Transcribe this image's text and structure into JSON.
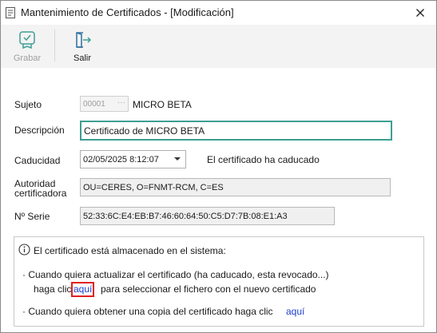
{
  "window": {
    "title": "Mantenimiento de Certificados - [Modificación]"
  },
  "toolbar": {
    "save_label": "Grabar",
    "exit_label": "Salir"
  },
  "form": {
    "subject_label": "Sujeto",
    "subject_code": "00001",
    "subject_name": "MICRO BETA",
    "description_label": "Descripción",
    "description_value": "Certificado de MICRO BETA",
    "expiry_label": "Caducidad",
    "expiry_value": "02/05/2025 8:12:07",
    "expiry_status": "El certificado ha caducado",
    "authority_label_line1": "Autoridad",
    "authority_label_line2": "certificadora",
    "authority_value": "OU=CERES, O=FNMT-RCM, C=ES",
    "serial_label": "Nº Serie",
    "serial_value": "52:33:6C:E4:EB:B7:46:60:64:50:C5:D7:7B:08:E1:A3"
  },
  "info": {
    "heading": "El certificado está almacenado en el sistema:",
    "update_line1": "· Cuando quiera actualizar el certificado (ha caducado, esta revocado...)",
    "update_line2_prefix": "haga clic",
    "update_link": "aquí",
    "update_line2_suffix": "para seleccionar el fichero con el nuevo certificado",
    "copy_line": "· Cuando quiera obtener una copia del certificado haga clic",
    "copy_link": "aquí"
  },
  "colors": {
    "link": "#1c3fd1",
    "focus_border": "#3e9e94",
    "highlight_box": "#e02020"
  }
}
